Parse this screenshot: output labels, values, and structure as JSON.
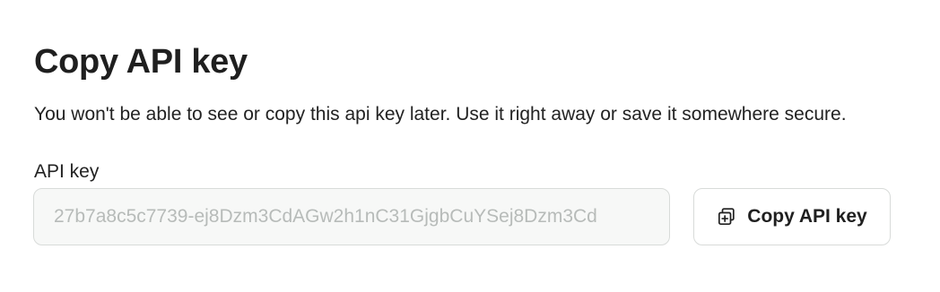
{
  "dialog": {
    "title": "Copy API key",
    "description": "You won't be able to see or copy this api key later. Use it right away or save it somewhere secure.",
    "field_label": "API key",
    "api_key_value": "27b7a8c5c7739-ej8Dzm3CdAGw2h1nC31GjgbCuYSej8Dzm3Cd",
    "copy_button": {
      "label": "Copy API key",
      "icon": "copy-icon"
    }
  },
  "colors": {
    "text": "#1f1f1f",
    "border": "#d8dbd9",
    "field_background": "#f7f8f7",
    "field_text": "#b7bbb9"
  }
}
